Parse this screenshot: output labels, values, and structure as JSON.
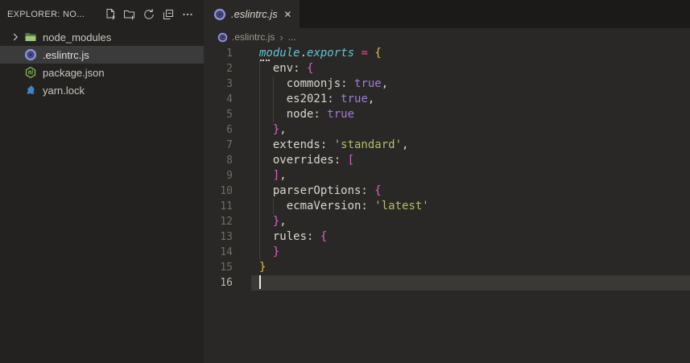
{
  "colors": {
    "sidebar-bg": "#242221",
    "sidebar-selected-bg": "#3b3b3b",
    "editor-bg": "#2a2826",
    "tabstrip-bg": "#1b1a19",
    "current-line-bg": "#3b3935",
    "text-ui": "#c9c6c0",
    "text-muted": "#9d9a94",
    "line-number": "#6e6c63",
    "line-number-active": "#bab8ae",
    "syntax-default": "#d8d6ce",
    "syntax-cyan": "#5fc4d5",
    "syntax-pink": "#e04d8e",
    "syntax-gold": "#ddbb4e",
    "syntax-orchid": "#d563c5",
    "syntax-purple": "#a07bd8",
    "syntax-string": "#b5bd68",
    "indent-guide": "#413f3b",
    "cursor": "#eeeeec",
    "icon-stroke": "#c5c5c5",
    "folder-dark": "#4f7a43",
    "folder-light": "#9dc777",
    "eslint-ring": "#8a8dd6",
    "eslint-fill": "#4b4e9b",
    "eslint-dot": "#262850",
    "npm-green": "#8cc152",
    "yarn-blue": "#3f86c4"
  },
  "sidebar": {
    "title": "EXPLORER: NO...",
    "actions": [
      {
        "name": "new-file",
        "label": "New File..."
      },
      {
        "name": "new-folder",
        "label": "New Folder..."
      },
      {
        "name": "refresh",
        "label": "Refresh Explorer"
      },
      {
        "name": "collapse-all",
        "label": "Collapse Folders in Explorer"
      },
      {
        "name": "more-actions",
        "label": "Views and More Actions..."
      }
    ],
    "files": [
      {
        "label": "node_modules",
        "kind": "folder",
        "icon": "folder-icon",
        "expanded": false,
        "selected": false
      },
      {
        "label": ".eslintrc.js",
        "kind": "file",
        "icon": "eslint-icon",
        "selected": true
      },
      {
        "label": "package.json",
        "kind": "file",
        "icon": "npm-icon",
        "selected": false
      },
      {
        "label": "yarn.lock",
        "kind": "file",
        "icon": "yarn-icon",
        "selected": false
      }
    ]
  },
  "tabbar": {
    "tabs": [
      {
        "label": ".eslintrc.js",
        "icon": "eslint-icon",
        "close": "✕",
        "active": true,
        "preview": true
      }
    ]
  },
  "breadcrumb": {
    "separator": "›",
    "items": [
      {
        "label": ".eslintrc.js",
        "icon": "eslint-icon"
      },
      {
        "label": "..."
      }
    ]
  },
  "editor": {
    "language": "javascript",
    "lines": [
      {
        "n": "1",
        "tokens": [
          {
            "t": "module",
            "c": "cyan",
            "hint": true
          },
          {
            "t": ".",
            "c": "def"
          },
          {
            "t": "exports",
            "c": "cyan"
          },
          {
            "t": " ",
            "c": "def"
          },
          {
            "t": "=",
            "c": "pink"
          },
          {
            "t": " ",
            "c": "def"
          },
          {
            "t": "{",
            "c": "gold"
          }
        ]
      },
      {
        "n": "2",
        "tokens": [
          {
            "t": "  env: ",
            "c": "def"
          },
          {
            "t": "{",
            "c": "orchid"
          }
        ]
      },
      {
        "n": "3",
        "tokens": [
          {
            "t": "    commonjs: ",
            "c": "def"
          },
          {
            "t": "true",
            "c": "purple"
          },
          {
            "t": ",",
            "c": "def"
          }
        ]
      },
      {
        "n": "4",
        "tokens": [
          {
            "t": "    es2021: ",
            "c": "def"
          },
          {
            "t": "true",
            "c": "purple"
          },
          {
            "t": ",",
            "c": "def"
          }
        ]
      },
      {
        "n": "5",
        "tokens": [
          {
            "t": "    node: ",
            "c": "def"
          },
          {
            "t": "true",
            "c": "purple"
          }
        ]
      },
      {
        "n": "6",
        "tokens": [
          {
            "t": "  ",
            "c": "def"
          },
          {
            "t": "}",
            "c": "orchid"
          },
          {
            "t": ",",
            "c": "def"
          }
        ]
      },
      {
        "n": "7",
        "tokens": [
          {
            "t": "  extends: ",
            "c": "def"
          },
          {
            "t": "'standard'",
            "c": "string"
          },
          {
            "t": ",",
            "c": "def"
          }
        ]
      },
      {
        "n": "8",
        "tokens": [
          {
            "t": "  overrides: ",
            "c": "def"
          },
          {
            "t": "[",
            "c": "orchid"
          }
        ]
      },
      {
        "n": "9",
        "tokens": [
          {
            "t": "  ",
            "c": "def"
          },
          {
            "t": "]",
            "c": "orchid"
          },
          {
            "t": ",",
            "c": "def"
          }
        ]
      },
      {
        "n": "10",
        "tokens": [
          {
            "t": "  parserOptions: ",
            "c": "def"
          },
          {
            "t": "{",
            "c": "orchid"
          }
        ]
      },
      {
        "n": "11",
        "tokens": [
          {
            "t": "    ecmaVersion: ",
            "c": "def"
          },
          {
            "t": "'latest'",
            "c": "string"
          }
        ]
      },
      {
        "n": "12",
        "tokens": [
          {
            "t": "  ",
            "c": "def"
          },
          {
            "t": "}",
            "c": "orchid"
          },
          {
            "t": ",",
            "c": "def"
          }
        ]
      },
      {
        "n": "13",
        "tokens": [
          {
            "t": "  rules: ",
            "c": "def"
          },
          {
            "t": "{",
            "c": "orchid"
          }
        ]
      },
      {
        "n": "14",
        "tokens": [
          {
            "t": "  ",
            "c": "def"
          },
          {
            "t": "}",
            "c": "orchid"
          }
        ]
      },
      {
        "n": "15",
        "tokens": [
          {
            "t": "}",
            "c": "gold"
          }
        ]
      },
      {
        "n": "16",
        "tokens": [],
        "cursor": true,
        "active": true
      }
    ]
  }
}
